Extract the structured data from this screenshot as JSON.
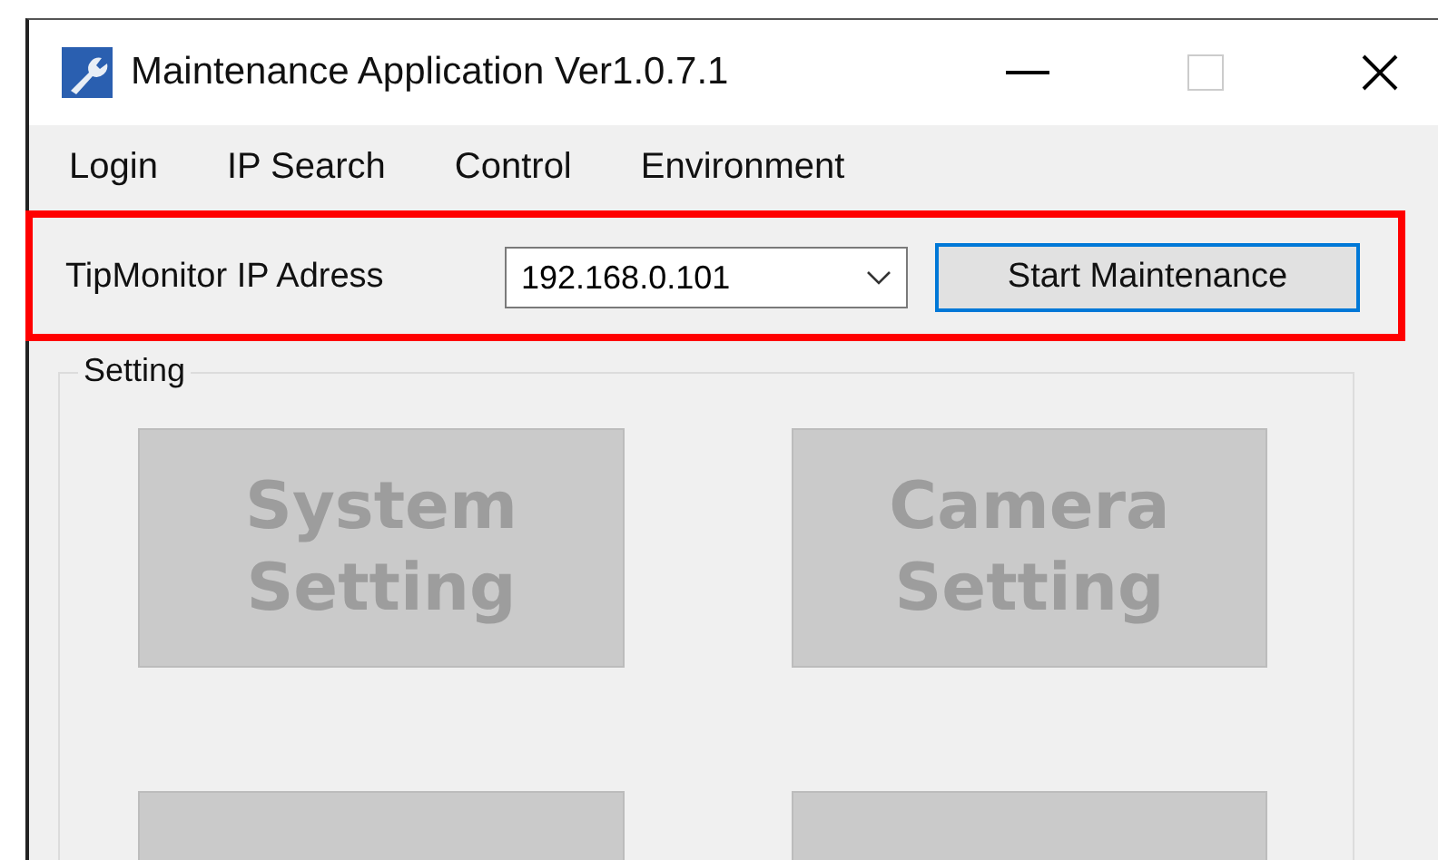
{
  "window": {
    "title": "Maintenance Application Ver1.0.7.1"
  },
  "menu": [
    {
      "label": "Login"
    },
    {
      "label": "IP Search"
    },
    {
      "label": "Control"
    },
    {
      "label": "Environment"
    }
  ],
  "connection": {
    "label": "TipMonitor IP Adress",
    "ip_value": "192.168.0.101",
    "start_button": "Start Maintenance",
    "start_focused": true
  },
  "setting": {
    "title": "Setting",
    "buttons": [
      {
        "label_lines": [
          "System",
          "Setting"
        ],
        "disabled": true
      },
      {
        "label_lines": [
          "Camera",
          "Setting"
        ],
        "disabled": true
      },
      {
        "disabled": true
      },
      {
        "disabled": true
      }
    ]
  }
}
